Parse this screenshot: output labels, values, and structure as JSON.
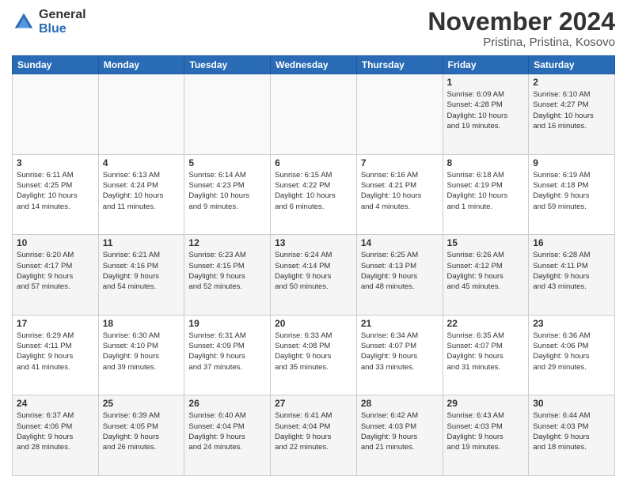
{
  "logo": {
    "general": "General",
    "blue": "Blue"
  },
  "title": "November 2024",
  "location": "Pristina, Pristina, Kosovo",
  "weekdays": [
    "Sunday",
    "Monday",
    "Tuesday",
    "Wednesday",
    "Thursday",
    "Friday",
    "Saturday"
  ],
  "weeks": [
    [
      {
        "day": "",
        "info": ""
      },
      {
        "day": "",
        "info": ""
      },
      {
        "day": "",
        "info": ""
      },
      {
        "day": "",
        "info": ""
      },
      {
        "day": "",
        "info": ""
      },
      {
        "day": "1",
        "info": "Sunrise: 6:09 AM\nSunset: 4:28 PM\nDaylight: 10 hours\nand 19 minutes."
      },
      {
        "day": "2",
        "info": "Sunrise: 6:10 AM\nSunset: 4:27 PM\nDaylight: 10 hours\nand 16 minutes."
      }
    ],
    [
      {
        "day": "3",
        "info": "Sunrise: 6:11 AM\nSunset: 4:25 PM\nDaylight: 10 hours\nand 14 minutes."
      },
      {
        "day": "4",
        "info": "Sunrise: 6:13 AM\nSunset: 4:24 PM\nDaylight: 10 hours\nand 11 minutes."
      },
      {
        "day": "5",
        "info": "Sunrise: 6:14 AM\nSunset: 4:23 PM\nDaylight: 10 hours\nand 9 minutes."
      },
      {
        "day": "6",
        "info": "Sunrise: 6:15 AM\nSunset: 4:22 PM\nDaylight: 10 hours\nand 6 minutes."
      },
      {
        "day": "7",
        "info": "Sunrise: 6:16 AM\nSunset: 4:21 PM\nDaylight: 10 hours\nand 4 minutes."
      },
      {
        "day": "8",
        "info": "Sunrise: 6:18 AM\nSunset: 4:19 PM\nDaylight: 10 hours\nand 1 minute."
      },
      {
        "day": "9",
        "info": "Sunrise: 6:19 AM\nSunset: 4:18 PM\nDaylight: 9 hours\nand 59 minutes."
      }
    ],
    [
      {
        "day": "10",
        "info": "Sunrise: 6:20 AM\nSunset: 4:17 PM\nDaylight: 9 hours\nand 57 minutes."
      },
      {
        "day": "11",
        "info": "Sunrise: 6:21 AM\nSunset: 4:16 PM\nDaylight: 9 hours\nand 54 minutes."
      },
      {
        "day": "12",
        "info": "Sunrise: 6:23 AM\nSunset: 4:15 PM\nDaylight: 9 hours\nand 52 minutes."
      },
      {
        "day": "13",
        "info": "Sunrise: 6:24 AM\nSunset: 4:14 PM\nDaylight: 9 hours\nand 50 minutes."
      },
      {
        "day": "14",
        "info": "Sunrise: 6:25 AM\nSunset: 4:13 PM\nDaylight: 9 hours\nand 48 minutes."
      },
      {
        "day": "15",
        "info": "Sunrise: 6:26 AM\nSunset: 4:12 PM\nDaylight: 9 hours\nand 45 minutes."
      },
      {
        "day": "16",
        "info": "Sunrise: 6:28 AM\nSunset: 4:11 PM\nDaylight: 9 hours\nand 43 minutes."
      }
    ],
    [
      {
        "day": "17",
        "info": "Sunrise: 6:29 AM\nSunset: 4:11 PM\nDaylight: 9 hours\nand 41 minutes."
      },
      {
        "day": "18",
        "info": "Sunrise: 6:30 AM\nSunset: 4:10 PM\nDaylight: 9 hours\nand 39 minutes."
      },
      {
        "day": "19",
        "info": "Sunrise: 6:31 AM\nSunset: 4:09 PM\nDaylight: 9 hours\nand 37 minutes."
      },
      {
        "day": "20",
        "info": "Sunrise: 6:33 AM\nSunset: 4:08 PM\nDaylight: 9 hours\nand 35 minutes."
      },
      {
        "day": "21",
        "info": "Sunrise: 6:34 AM\nSunset: 4:07 PM\nDaylight: 9 hours\nand 33 minutes."
      },
      {
        "day": "22",
        "info": "Sunrise: 6:35 AM\nSunset: 4:07 PM\nDaylight: 9 hours\nand 31 minutes."
      },
      {
        "day": "23",
        "info": "Sunrise: 6:36 AM\nSunset: 4:06 PM\nDaylight: 9 hours\nand 29 minutes."
      }
    ],
    [
      {
        "day": "24",
        "info": "Sunrise: 6:37 AM\nSunset: 4:06 PM\nDaylight: 9 hours\nand 28 minutes."
      },
      {
        "day": "25",
        "info": "Sunrise: 6:39 AM\nSunset: 4:05 PM\nDaylight: 9 hours\nand 26 minutes."
      },
      {
        "day": "26",
        "info": "Sunrise: 6:40 AM\nSunset: 4:04 PM\nDaylight: 9 hours\nand 24 minutes."
      },
      {
        "day": "27",
        "info": "Sunrise: 6:41 AM\nSunset: 4:04 PM\nDaylight: 9 hours\nand 22 minutes."
      },
      {
        "day": "28",
        "info": "Sunrise: 6:42 AM\nSunset: 4:03 PM\nDaylight: 9 hours\nand 21 minutes."
      },
      {
        "day": "29",
        "info": "Sunrise: 6:43 AM\nSunset: 4:03 PM\nDaylight: 9 hours\nand 19 minutes."
      },
      {
        "day": "30",
        "info": "Sunrise: 6:44 AM\nSunset: 4:03 PM\nDaylight: 9 hours\nand 18 minutes."
      }
    ]
  ]
}
